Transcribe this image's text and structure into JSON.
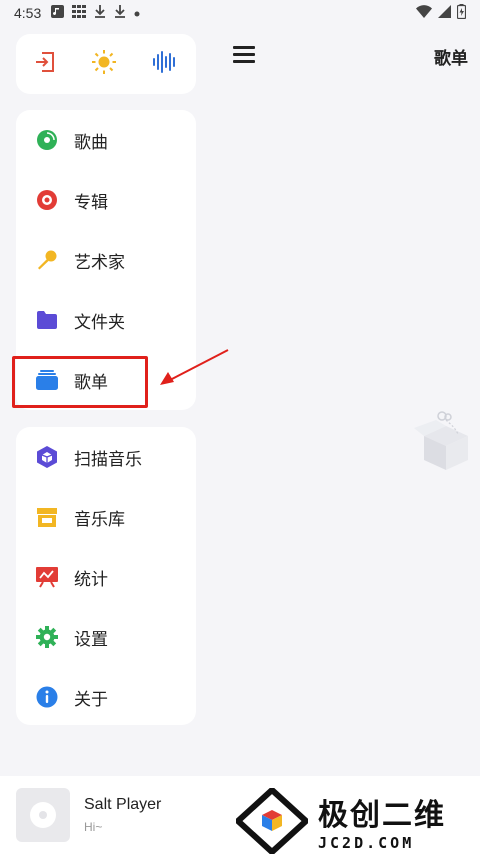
{
  "status_bar": {
    "time": "4:53",
    "icons": [
      "music-note-icon",
      "grid-icon",
      "download-icon",
      "download-icon",
      "dot-icon"
    ],
    "right_icons": [
      "wifi-icon",
      "signal-icon",
      "battery-icon"
    ]
  },
  "quick_actions": [
    {
      "name": "exit-icon",
      "color": "#e0503c"
    },
    {
      "name": "sun-icon",
      "color": "#f2b623"
    },
    {
      "name": "waveform-icon",
      "color": "#2f6fd6"
    }
  ],
  "nav_primary": [
    {
      "label": "歌曲",
      "icon": "disc-icon",
      "color": "#2fb157"
    },
    {
      "label": "专辑",
      "icon": "album-icon",
      "color": "#e23c36"
    },
    {
      "label": "艺术家",
      "icon": "microphone-icon",
      "color": "#f2b623"
    },
    {
      "label": "文件夹",
      "icon": "folder-icon",
      "color": "#5b4bd6"
    },
    {
      "label": "歌单",
      "icon": "playlist-icon",
      "color": "#2a7fe8"
    }
  ],
  "nav_secondary": [
    {
      "label": "扫描音乐",
      "icon": "scan-icon",
      "color": "#5b4bd6"
    },
    {
      "label": "音乐库",
      "icon": "store-icon",
      "color": "#f2b623"
    },
    {
      "label": "统计",
      "icon": "chart-icon",
      "color": "#e23c36"
    },
    {
      "label": "设置",
      "icon": "gear-icon",
      "color": "#2fb157"
    },
    {
      "label": "关于",
      "icon": "info-icon",
      "color": "#2a7fe8"
    }
  ],
  "main": {
    "title": "歌单"
  },
  "player": {
    "title": "Salt Player",
    "subtitle": "Hi~"
  },
  "watermark": {
    "cn": "极创二维",
    "en": "JC2D.COM"
  },
  "annotation_color": "#e0201b"
}
